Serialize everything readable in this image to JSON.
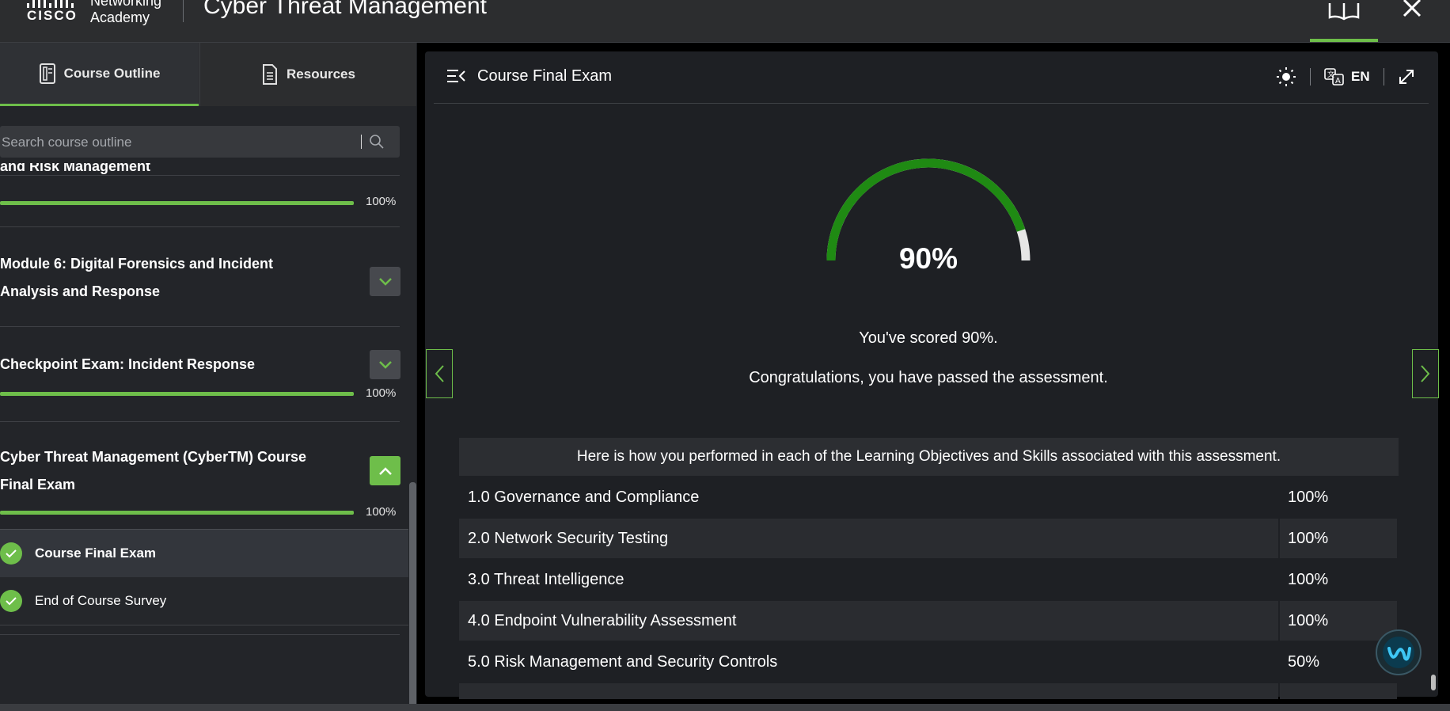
{
  "header": {
    "brand_top": "Networking",
    "brand_cisco": "CISCO",
    "brand_bottom": "Academy",
    "app_title": "Cyber Threat Management",
    "book_icon": "book-open-icon",
    "close_icon": "close-icon"
  },
  "sidebar": {
    "tabs": [
      {
        "label": "Course Outline",
        "icon": "document-outline-icon",
        "active": true
      },
      {
        "label": "Resources",
        "icon": "document-icon",
        "active": false
      }
    ],
    "search": {
      "placeholder": "Search course outline"
    },
    "modules": [
      {
        "title": "and Risk Management",
        "progress_pct": 100,
        "progress_label": "100%"
      },
      {
        "title": "Module 6: Digital Forensics and Incident Analysis and Response",
        "expanded": false
      },
      {
        "title": "Checkpoint Exam: Incident Response",
        "progress_pct": 100,
        "progress_label": "100%",
        "expanded": false
      },
      {
        "title": "Cyber Threat Management (CyberTM) Course Final Exam",
        "progress_pct": 100,
        "progress_label": "100%",
        "expanded": true
      }
    ],
    "sub_items": [
      {
        "label": "Course Final Exam",
        "completed": true,
        "selected": true
      },
      {
        "label": "End of Course Survey",
        "completed": true,
        "selected": false
      }
    ]
  },
  "main": {
    "title": "Course Final Exam",
    "language": "EN",
    "score": {
      "value_pct": 90,
      "label": "90%"
    },
    "scored_text": "You've scored 90%.",
    "congrats_text": "Congratulations, you have passed the assessment.",
    "performance_header": "Here is how you performed in each of the Learning Objectives and Skills associated with this assessment.",
    "objectives": [
      {
        "name": "1.0 Governance and Compliance",
        "score": "100%"
      },
      {
        "name": "2.0 Network Security Testing",
        "score": "100%"
      },
      {
        "name": "3.0 Threat Intelligence",
        "score": "100%"
      },
      {
        "name": "4.0 Endpoint Vulnerability Assessment",
        "score": "100%"
      },
      {
        "name": "5.0 Risk Management and Security Controls",
        "score": "50%"
      }
    ]
  },
  "colors": {
    "accent_green": "#6ebe4a",
    "gauge_green": "#1f8a13",
    "gauge_track": "#e6e6e6"
  }
}
